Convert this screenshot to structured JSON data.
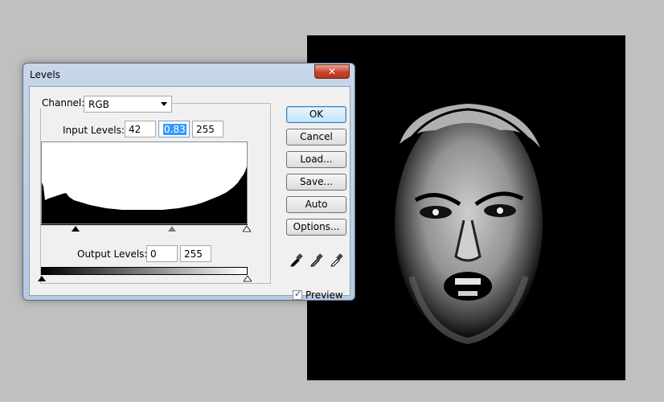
{
  "dialog": {
    "title": "Levels",
    "close_icon": "close-icon",
    "channel_label": "Channel:",
    "channel_value": "RGB",
    "input_levels_label": "Input Levels:",
    "input_black": "42",
    "input_gamma": "0.83",
    "input_white": "255",
    "output_levels_label": "Output Levels:",
    "output_black": "0",
    "output_white": "255",
    "buttons": {
      "ok": "OK",
      "cancel": "Cancel",
      "load": "Load...",
      "save": "Save...",
      "auto": "Auto",
      "options": "Options..."
    },
    "eyedroppers": [
      "black-eyedropper-icon",
      "gray-eyedropper-icon",
      "white-eyedropper-icon"
    ],
    "preview_label": "Preview",
    "preview_checked": true
  },
  "canvas": {
    "description_icon": "face-photo"
  }
}
